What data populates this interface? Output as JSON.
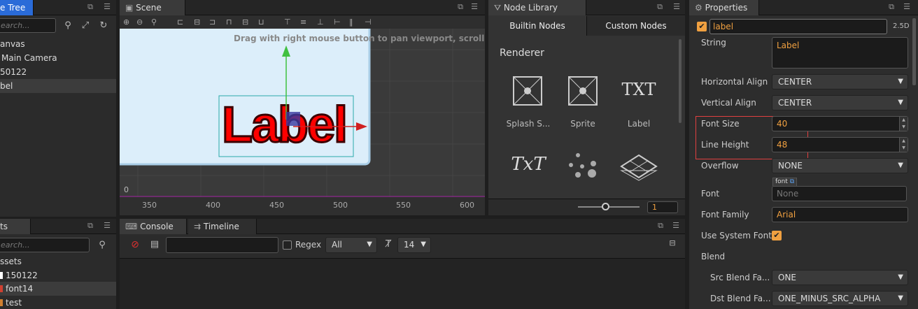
{
  "node_tree": {
    "tab": "e Tree",
    "search_placeholder": "earch...",
    "items": [
      "anvas",
      "Main Camera",
      "50122",
      "bel"
    ]
  },
  "scene": {
    "tab": "Scene",
    "hint": "Drag with right mouse button to pan viewport, scroll to zoom.",
    "label_text": "Label",
    "axis_y": "0",
    "ruler": [
      "350",
      "400",
      "450",
      "500",
      "550",
      "600"
    ]
  },
  "node_library": {
    "tab": "Node Library",
    "tabs": [
      "Builtin Nodes",
      "Custom Nodes"
    ],
    "section": "Renderer",
    "nodes": [
      {
        "name": "Splash S...",
        "icon": "splash-sprite-icon"
      },
      {
        "name": "Sprite",
        "icon": "sprite-icon"
      },
      {
        "name": "Label",
        "icon": "label-icon",
        "glyph": "TXT"
      },
      {
        "name": "",
        "icon": "richtext-icon",
        "glyph": "TxT"
      },
      {
        "name": "",
        "icon": "particle-icon"
      },
      {
        "name": "",
        "icon": "tiledmap-icon"
      }
    ],
    "zoom_value": "1"
  },
  "properties": {
    "tab": "Properties",
    "node_name": "label",
    "mode": "2.5D",
    "string_label": "String",
    "string_value": "Label",
    "rows": {
      "halign": {
        "label": "Horizontal Align",
        "value": "CENTER"
      },
      "valign": {
        "label": "Vertical Align",
        "value": "CENTER"
      },
      "font_size": {
        "label": "Font Size",
        "value": "40"
      },
      "line_height": {
        "label": "Line Height",
        "value": "48"
      },
      "overflow": {
        "label": "Overflow",
        "value": "NONE"
      },
      "font": {
        "label": "Font",
        "tag": "font",
        "value": "None"
      },
      "font_family": {
        "label": "Font Family",
        "value": "Arial"
      },
      "use_system_font": {
        "label": "Use System Font"
      },
      "blend": {
        "label": "Blend"
      },
      "src_blend": {
        "label": "Src Blend Fa...",
        "value": "ONE"
      },
      "dst_blend": {
        "label": "Dst Blend Fa...",
        "value": "ONE_MINUS_SRC_ALPHA"
      }
    }
  },
  "assets": {
    "tab": "ts",
    "search_placeholder": "earch...",
    "items": [
      "ssets",
      "150122",
      "font14",
      "test"
    ]
  },
  "console": {
    "tabs": [
      "Console",
      "Timeline"
    ],
    "regex_label": "Regex",
    "filter": "All",
    "font_size": "14"
  },
  "colors": {
    "accent": "#f0a040",
    "highlight_box": "#e04040"
  }
}
